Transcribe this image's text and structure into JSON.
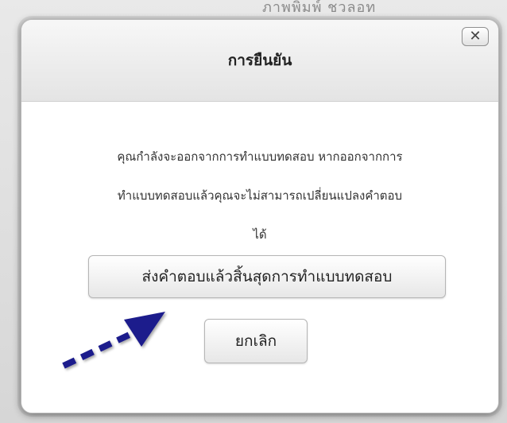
{
  "background": {
    "partial_text": "ภาพพิมพ์ ชวลอท"
  },
  "dialog": {
    "title": "การยืนยัน",
    "close_label": "✕",
    "message_lines": [
      "คุณกำลังจะออกจากการทำแบบทดสอบ หากออกจากการ",
      "ทำแบบทดสอบแล้วคุณจะไม่สามารถเปลี่ยนแปลงคำตอบ",
      "ได้"
    ],
    "submit_label": "ส่งคำตอบแล้วสิ้นสุดการทำแบบทดสอบ",
    "cancel_label": "ยกเลิก"
  },
  "annotation": {
    "arrow_icon": "dashed-arrow-icon",
    "arrow_color": "#1c1c8c"
  }
}
